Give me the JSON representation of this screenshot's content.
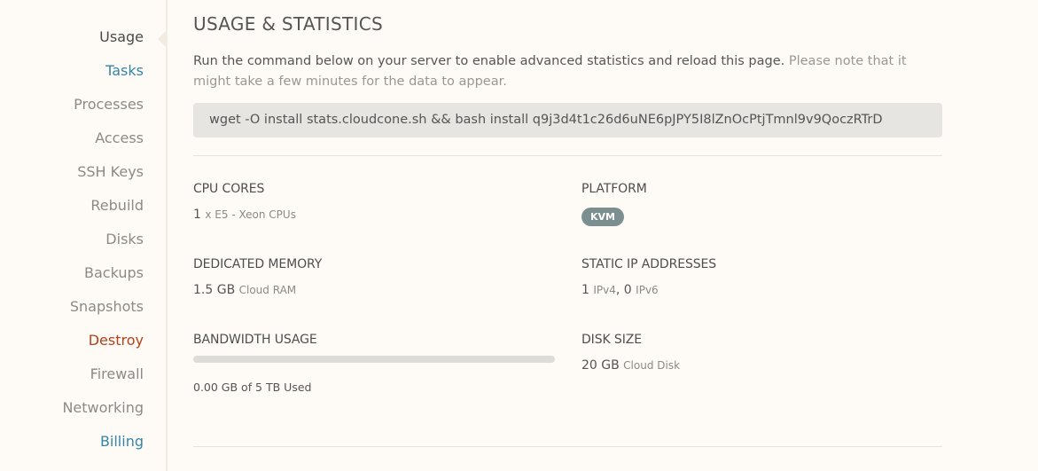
{
  "sidebar": {
    "items": [
      {
        "label": "Usage",
        "state": "active"
      },
      {
        "label": "Tasks",
        "state": "accent"
      },
      {
        "label": "Processes",
        "state": "normal"
      },
      {
        "label": "Access",
        "state": "normal"
      },
      {
        "label": "SSH Keys",
        "state": "normal"
      },
      {
        "label": "Rebuild",
        "state": "normal"
      },
      {
        "label": "Disks",
        "state": "normal"
      },
      {
        "label": "Backups",
        "state": "normal"
      },
      {
        "label": "Snapshots",
        "state": "normal"
      },
      {
        "label": "Destroy",
        "state": "danger"
      },
      {
        "label": "Firewall",
        "state": "normal"
      },
      {
        "label": "Networking",
        "state": "normal"
      },
      {
        "label": "Billing",
        "state": "accent"
      }
    ]
  },
  "page": {
    "title": "USAGE & STATISTICS",
    "intro": "Run the command below on your server to enable advanced statistics and reload this page.",
    "intro_note": "Please note that it might take a few minutes for the data to appear.",
    "command": "wget -O install stats.cloudcone.sh && bash install q9j3d4t1c26d6uNE6pJPY5I8lZnOcPtjTmnl9v9QoczRTrD"
  },
  "stats": {
    "cpu": {
      "label": "CPU CORES",
      "count": "1",
      "detail": "x E5 - Xeon CPUs"
    },
    "platform": {
      "label": "PLATFORM",
      "badge": "KVM"
    },
    "memory": {
      "label": "DEDICATED MEMORY",
      "value": "1.5 GB",
      "unit": "Cloud RAM"
    },
    "ip": {
      "label": "STATIC IP ADDRESSES",
      "ipv4_count": "1",
      "ipv4_label": "IPv4",
      "separator": ",",
      "ipv6_count": "0",
      "ipv6_label": "IPv6"
    },
    "bandwidth": {
      "label": "BANDWIDTH USAGE",
      "used_fraction": 0,
      "usage_text": "0.00 GB of 5 TB Used"
    },
    "disk": {
      "label": "DISK SIZE",
      "value": "20 GB",
      "unit": "Cloud Disk"
    }
  },
  "colors": {
    "accent": "#3585a8",
    "danger": "#b2411c",
    "badge": "#7b8f91",
    "background": "#fefbf6"
  }
}
